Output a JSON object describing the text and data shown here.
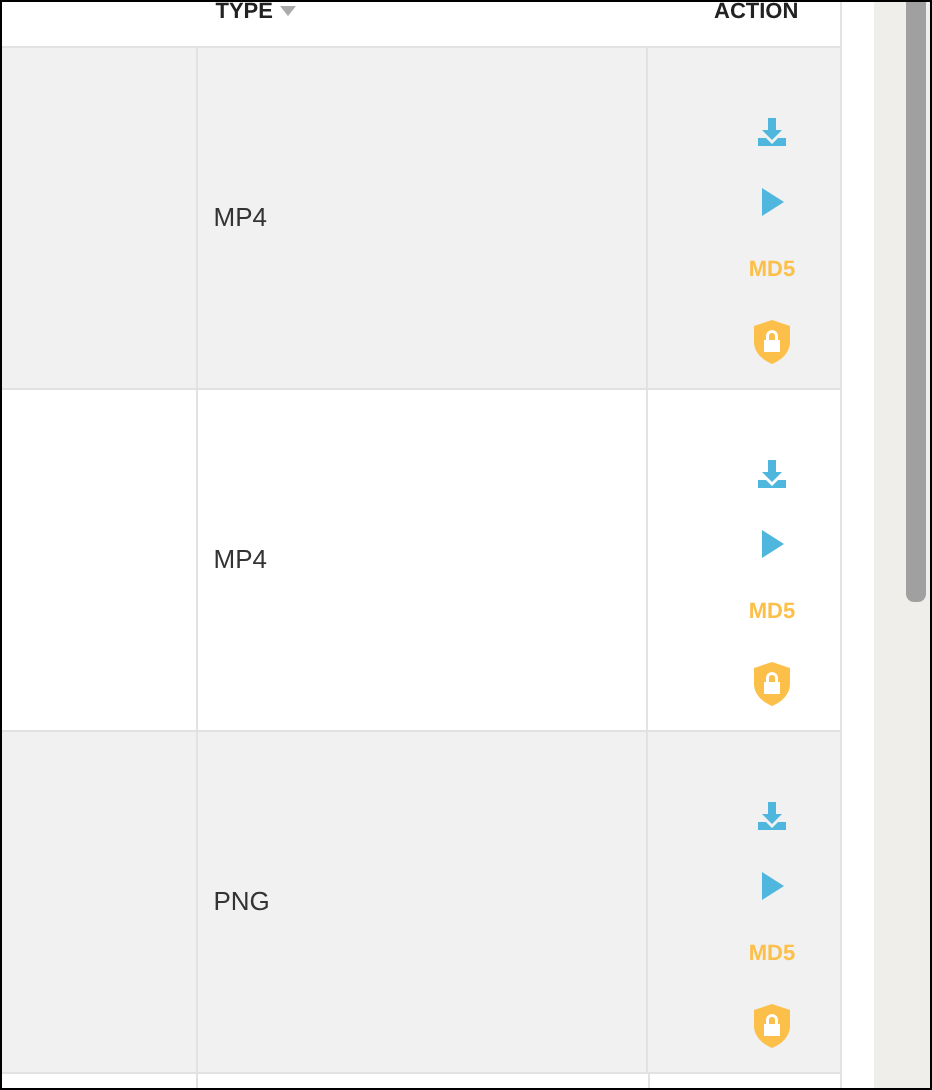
{
  "table": {
    "columns": [
      {
        "label": "TYPE",
        "sortable": true
      },
      {
        "label": "ACTION",
        "sortable": false
      }
    ],
    "rows": [
      {
        "type": "MP4",
        "actions": [
          {
            "kind": "download"
          },
          {
            "kind": "play"
          },
          {
            "kind": "md5",
            "label": "MD5"
          },
          {
            "kind": "lock"
          }
        ]
      },
      {
        "type": "MP4",
        "actions": [
          {
            "kind": "download"
          },
          {
            "kind": "play"
          },
          {
            "kind": "md5",
            "label": "MD5"
          },
          {
            "kind": "lock"
          }
        ]
      },
      {
        "type": "PNG",
        "actions": [
          {
            "kind": "download"
          },
          {
            "kind": "play"
          },
          {
            "kind": "md5",
            "label": "MD5"
          },
          {
            "kind": "lock"
          }
        ]
      }
    ]
  }
}
